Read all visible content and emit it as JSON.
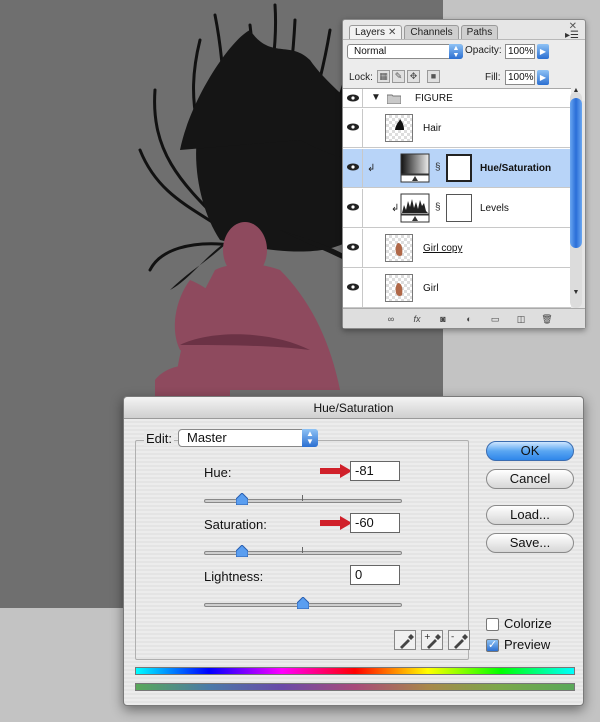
{
  "layers_panel": {
    "tabs": [
      {
        "label": "Layers",
        "active": true
      },
      {
        "label": "Channels",
        "active": false
      },
      {
        "label": "Paths",
        "active": false
      }
    ],
    "blend_mode": "Normal",
    "opacity_label": "Opacity:",
    "opacity_value": "100%",
    "lock_label": "Lock:",
    "fill_label": "Fill:",
    "fill_value": "100%",
    "layers": [
      {
        "name": "FIGURE",
        "type": "group"
      },
      {
        "name": "Hair"
      },
      {
        "name": "Hue/Saturation",
        "selected": true,
        "adjustment": true
      },
      {
        "name": "Levels",
        "adjustment": true
      },
      {
        "name": "Girl copy"
      },
      {
        "name": "Girl"
      }
    ]
  },
  "dialog": {
    "title": "Hue/Saturation",
    "edit_label": "Edit:",
    "edit_value": "Master",
    "hue_label": "Hue:",
    "hue_value": "-81",
    "saturation_label": "Saturation:",
    "saturation_value": "-60",
    "lightness_label": "Lightness:",
    "lightness_value": "0",
    "buttons": {
      "ok": "OK",
      "cancel": "Cancel",
      "load": "Load...",
      "save": "Save..."
    },
    "colorize_label": "Colorize",
    "colorize_checked": false,
    "preview_label": "Preview",
    "preview_checked": true
  }
}
